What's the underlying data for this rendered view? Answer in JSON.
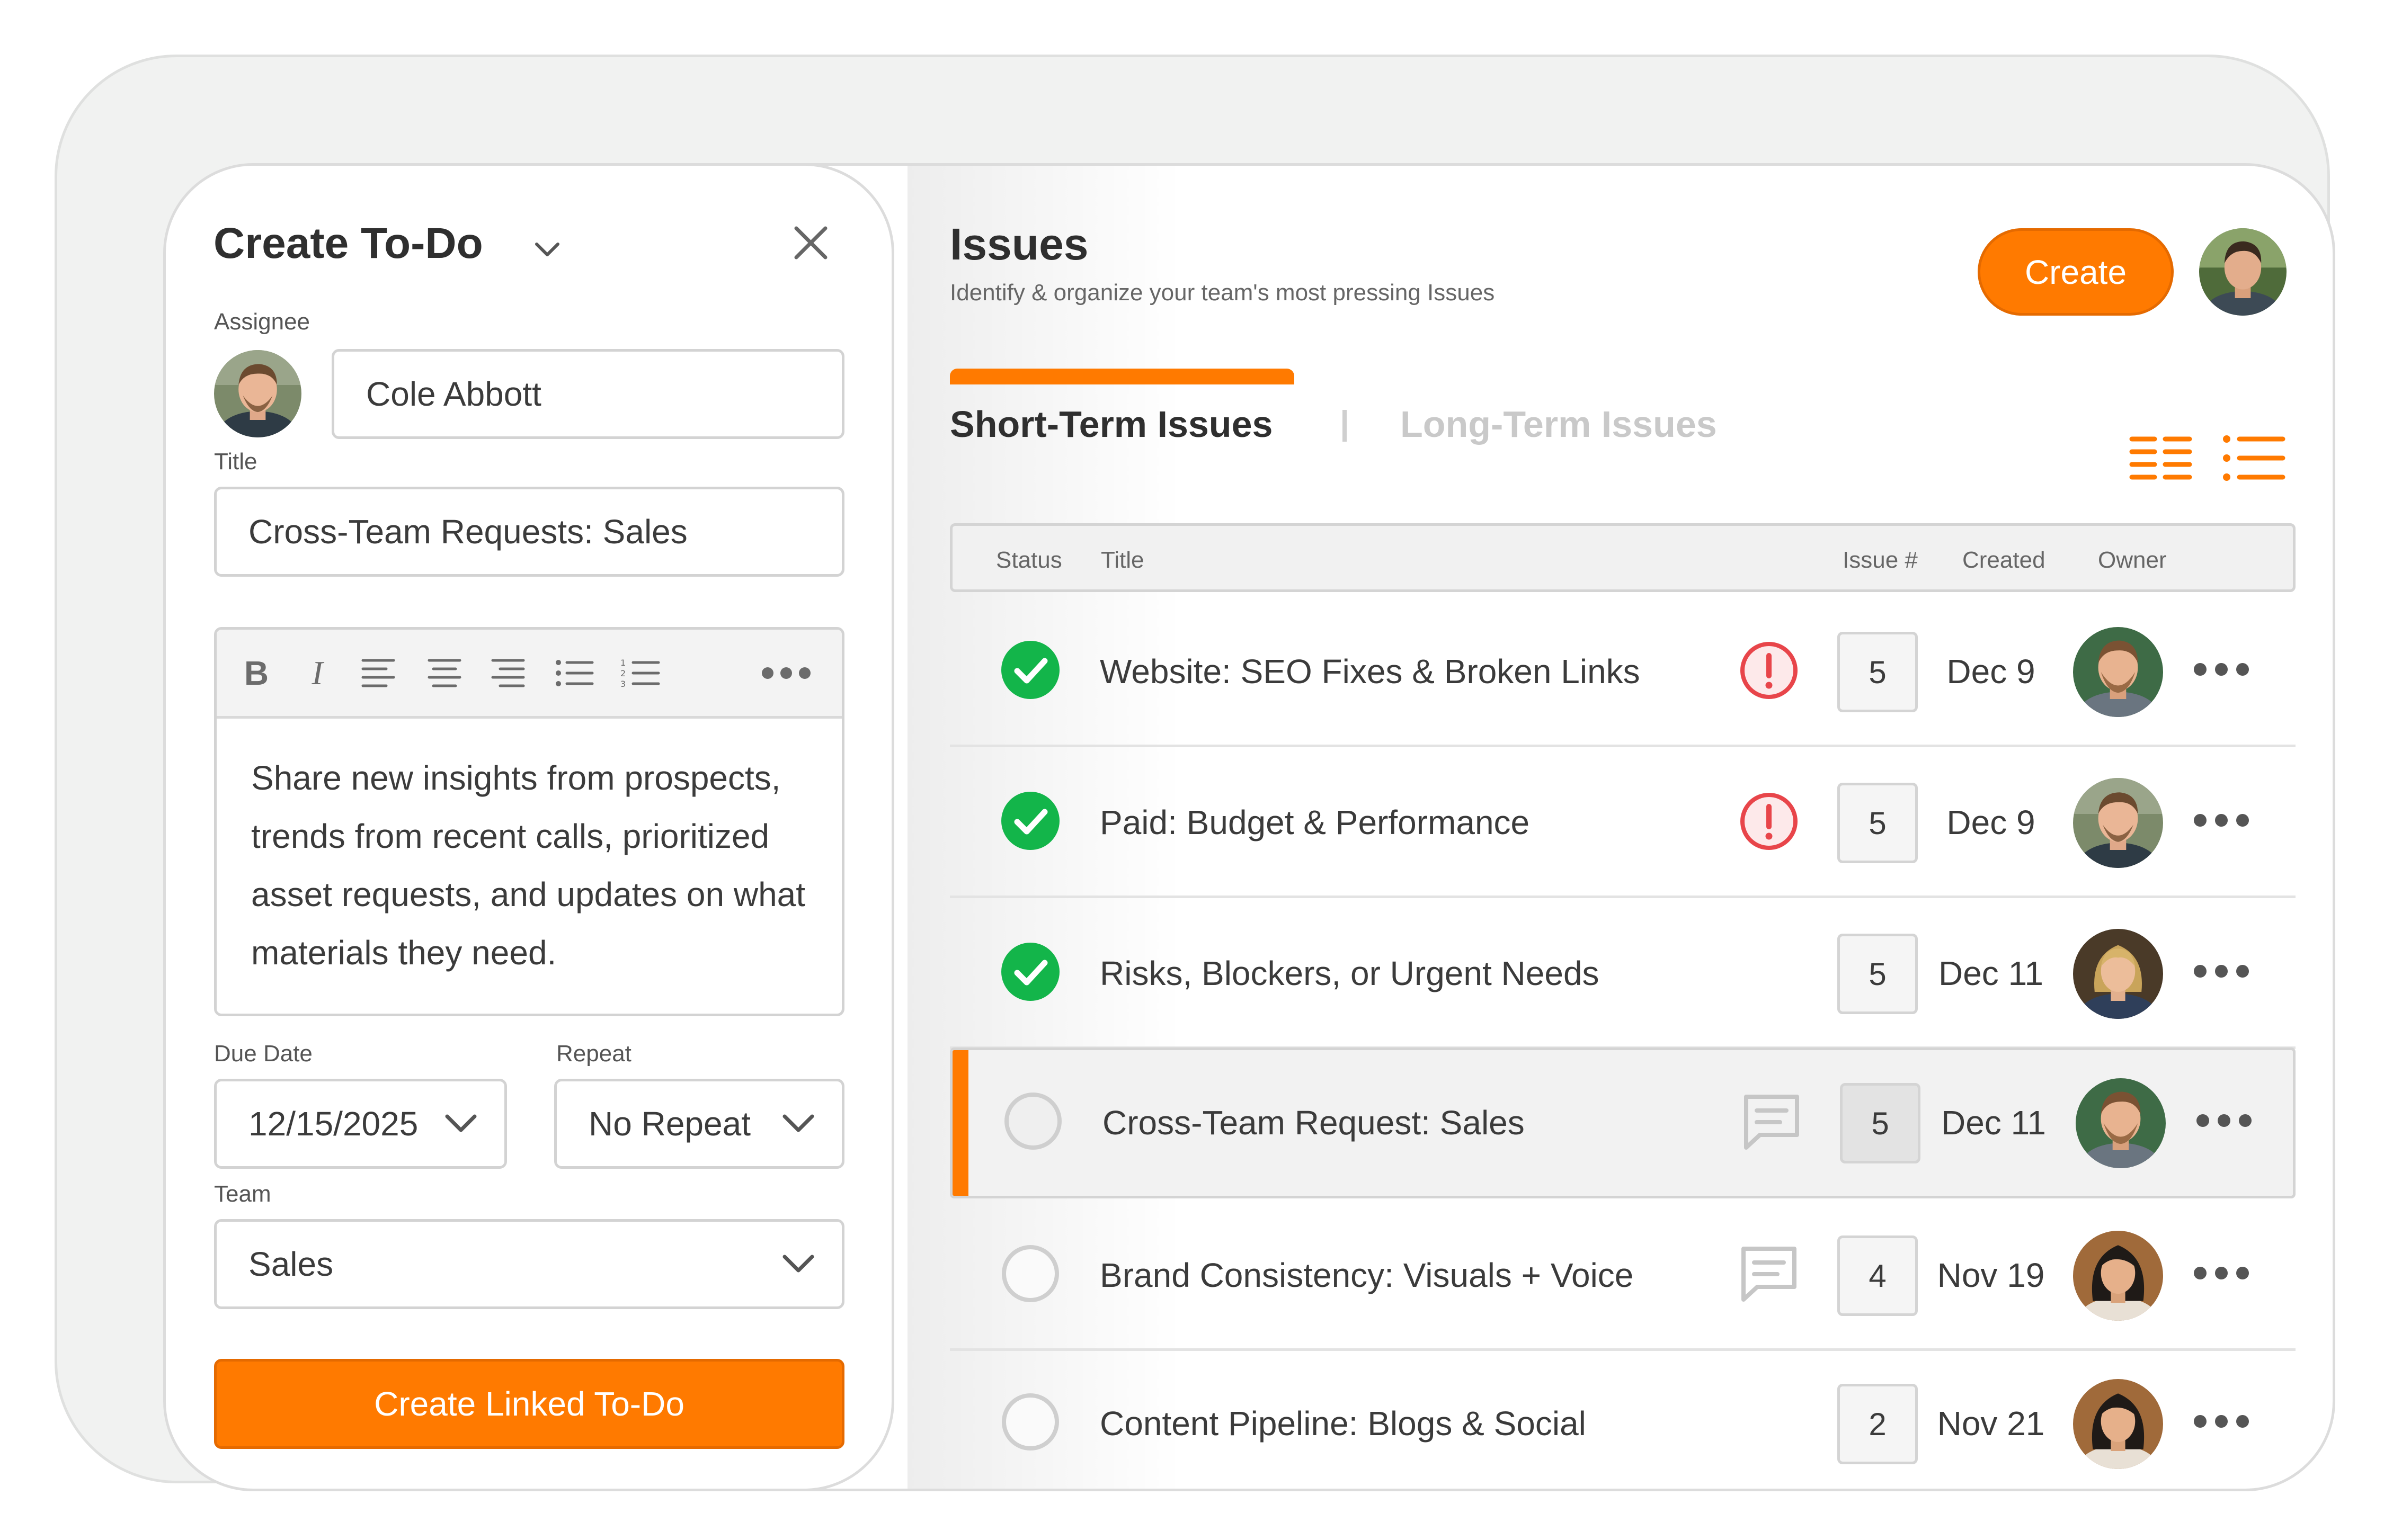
{
  "todo_panel": {
    "title": "Create To-Do",
    "assignee_label": "Assignee",
    "assignee_value": "Cole Abbott",
    "title_label": "Title",
    "title_value": "Cross-Team Requests: Sales",
    "editor_toolbar": [
      "bold-icon",
      "italic-icon",
      "align-left-icon",
      "align-center-icon",
      "align-right-icon",
      "bulleted-list-icon",
      "numbered-list-icon",
      "more-icon"
    ],
    "editor_text": "Share new insights from prospects, trends from recent calls, prioritized asset requests, and updates on what materials they need.",
    "due_date_label": "Due Date",
    "due_date_value": "12/15/2025",
    "repeat_label": "Repeat",
    "repeat_value": "No Repeat",
    "team_label": "Team",
    "team_value": "Sales",
    "submit_label": "Create Linked To-Do"
  },
  "issues": {
    "title": "Issues",
    "subtitle": "Identify & organize your team's most pressing Issues",
    "create_label": "Create",
    "tabs": [
      {
        "label": "Short-Term Issues",
        "active": true
      },
      {
        "label": "Long-Term Issues",
        "active": false
      }
    ],
    "columns": {
      "status": "Status",
      "title": "Title",
      "issue": "Issue #",
      "created": "Created",
      "owner": "Owner"
    },
    "rows": [
      {
        "title": "Website: SEO Fixes & Broken Links",
        "status": "done",
        "flag": "alert",
        "number": "5",
        "created": "Dec 9"
      },
      {
        "title": "Paid: Budget & Performance",
        "status": "done",
        "flag": "alert",
        "number": "5",
        "created": "Dec 9"
      },
      {
        "title": "Risks, Blockers, or Urgent Needs",
        "status": "done",
        "flag": "none",
        "number": "5",
        "created": "Dec 11"
      },
      {
        "title": "Cross-Team Request: Sales",
        "status": "open",
        "flag": "comment",
        "number": "5",
        "created": "Dec 11",
        "selected": true
      },
      {
        "title": "Brand Consistency: Visuals + Voice",
        "status": "open",
        "flag": "comment",
        "number": "4",
        "created": "Nov 19"
      },
      {
        "title": "Content Pipeline: Blogs & Social",
        "status": "open",
        "flag": "none",
        "number": "2",
        "created": "Nov 21"
      }
    ]
  },
  "colors": {
    "accent": "#ff7a00",
    "success": "#13b54a",
    "alert": "#e8454a",
    "muted_tab": "#c9c9c9"
  }
}
